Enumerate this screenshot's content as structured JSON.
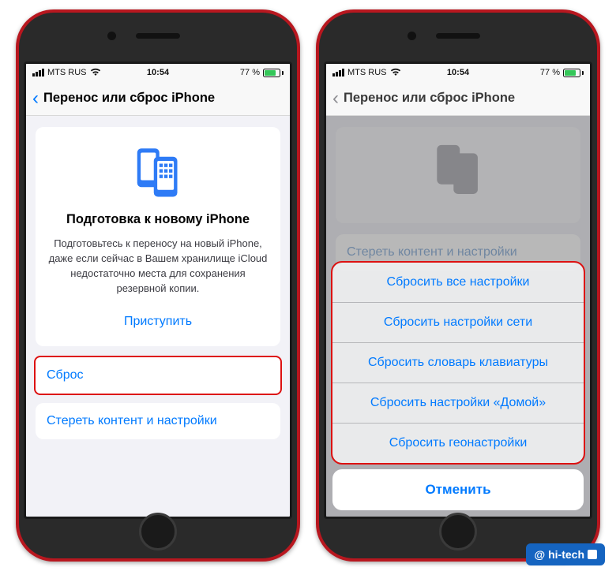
{
  "status": {
    "carrier": "MTS RUS",
    "time": "10:54",
    "battery_pct": "77 %"
  },
  "left": {
    "nav_title": "Перенос или сброс iPhone",
    "card": {
      "title": "Подготовка к новому iPhone",
      "body": "Подготовьтесь к переносу на новый iPhone, даже если сейчас в Вашем хранилище iCloud недостаточно места для сохранения резервной копии.",
      "cta": "Приступить"
    },
    "rows": {
      "reset": "Сброс",
      "erase": "Стереть контент и настройки"
    }
  },
  "right": {
    "nav_title": "Перенос или сброс iPhone",
    "ghost_row": "Стереть контент и настройки",
    "sheet": {
      "items": [
        "Сбросить все настройки",
        "Сбросить настройки сети",
        "Сбросить словарь клавиатуры",
        "Сбросить настройки «Домой»",
        "Сбросить геонастройки"
      ],
      "cancel": "Отменить"
    }
  },
  "watermark": "hi-tech"
}
